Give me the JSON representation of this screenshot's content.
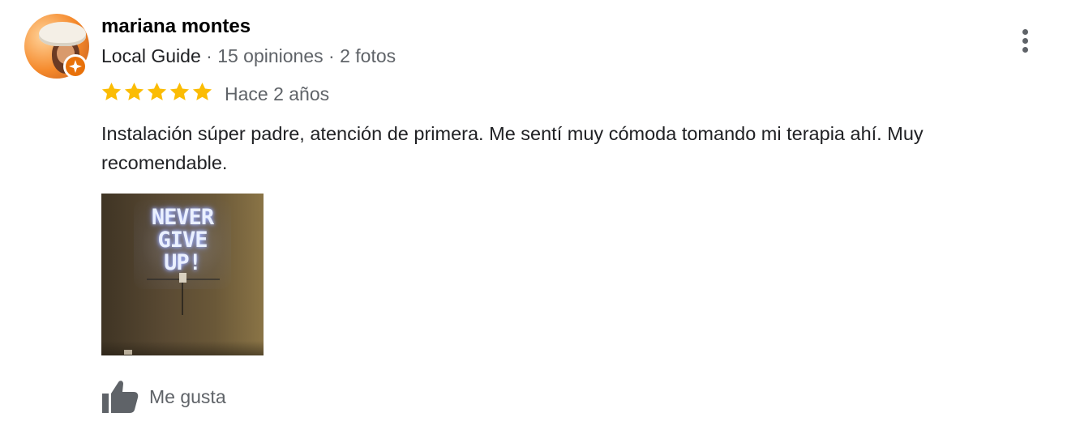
{
  "review": {
    "author": "mariana montes",
    "guide_label": "Local Guide",
    "separator": " · ",
    "reviews_count": "15 opiniones",
    "photos_count": "2 fotos",
    "rating": 5,
    "max_rating": 5,
    "time_ago": "Hace 2 años",
    "text": "Instalación súper padre, atención de primera. Me sentí muy cómoda tomando mi terapia ahí. Muy recomendable.",
    "photo": {
      "neon_lines": [
        "NEVER",
        "GIVE",
        "UP!"
      ]
    },
    "like_label": "Me gusta"
  },
  "colors": {
    "star": "#fbbc04",
    "badge": "#e8710a",
    "secondary_text": "#5f6368",
    "primary_text": "#202124"
  },
  "icons": {
    "badge": "local-guide-badge-icon",
    "more": "more-vert-icon",
    "star": "star-icon",
    "like": "thumb-up-icon"
  }
}
